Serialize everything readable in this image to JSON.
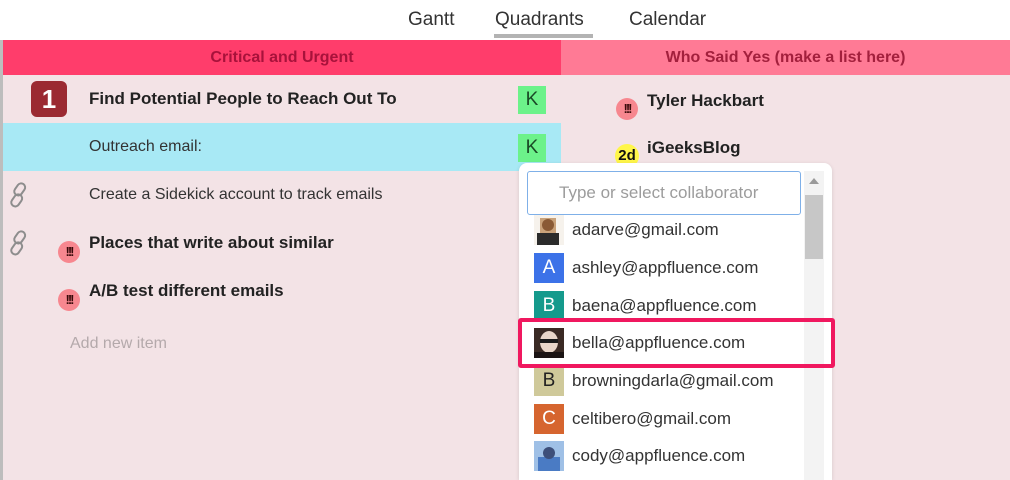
{
  "nav": {
    "tabs": [
      "Gantt",
      "Quadrants",
      "Calendar"
    ],
    "active": "Quadrants"
  },
  "left": {
    "header": "Critical and Urgent",
    "rows": [
      {
        "type": "task",
        "badge": "1",
        "title": "Find Potential People to Reach Out To",
        "assignee": "K"
      },
      {
        "type": "subtask",
        "title": "Outreach email:",
        "assignee": "K",
        "highlighted": true
      },
      {
        "type": "subtask",
        "title": "Create a Sidekick account to track emails",
        "icon": "link-icon"
      },
      {
        "type": "task",
        "title": "Places that write about similar",
        "icon": "link-icon",
        "priority": "!!!"
      },
      {
        "type": "task",
        "title": "A/B test different emails",
        "priority": "!!!"
      }
    ],
    "add_new": "Add new item"
  },
  "right": {
    "header": "Who Said Yes (make a list here)",
    "items": [
      {
        "title": "Tyler Hackbart",
        "badge": "!!!"
      },
      {
        "title": "iGeeksBlog",
        "badge": "2d"
      }
    ]
  },
  "collaborator_dropdown": {
    "placeholder": "Type or select collaborator",
    "options": [
      {
        "email": "adarve@gmail.com",
        "avatar": "photo",
        "avatar_color": "#c9a27a"
      },
      {
        "email": "ashley@appfluence.com",
        "avatar": "A",
        "avatar_color": "#3c72e8"
      },
      {
        "email": "baena@appfluence.com",
        "avatar": "B",
        "avatar_color": "#159a8c"
      },
      {
        "email": "bella@appfluence.com",
        "avatar": "photo",
        "avatar_color": "#3a2a24",
        "selected": true
      },
      {
        "email": "browningdarla@gmail.com",
        "avatar": "B",
        "avatar_color": "#cfc99a"
      },
      {
        "email": "celtibero@gmail.com",
        "avatar": "C",
        "avatar_color": "#d6652f"
      },
      {
        "email": "cody@appfluence.com",
        "avatar": "photo",
        "avatar_color": "#4a7bc4"
      }
    ]
  },
  "colors": {
    "critical_header": "#ff3d6b",
    "who_header": "#ff7a95",
    "pane_bg": "#f3e3e6",
    "highlight_row": "#a8e9f5",
    "assignee": "#6cf28a",
    "selection_box": "#f0185f"
  }
}
